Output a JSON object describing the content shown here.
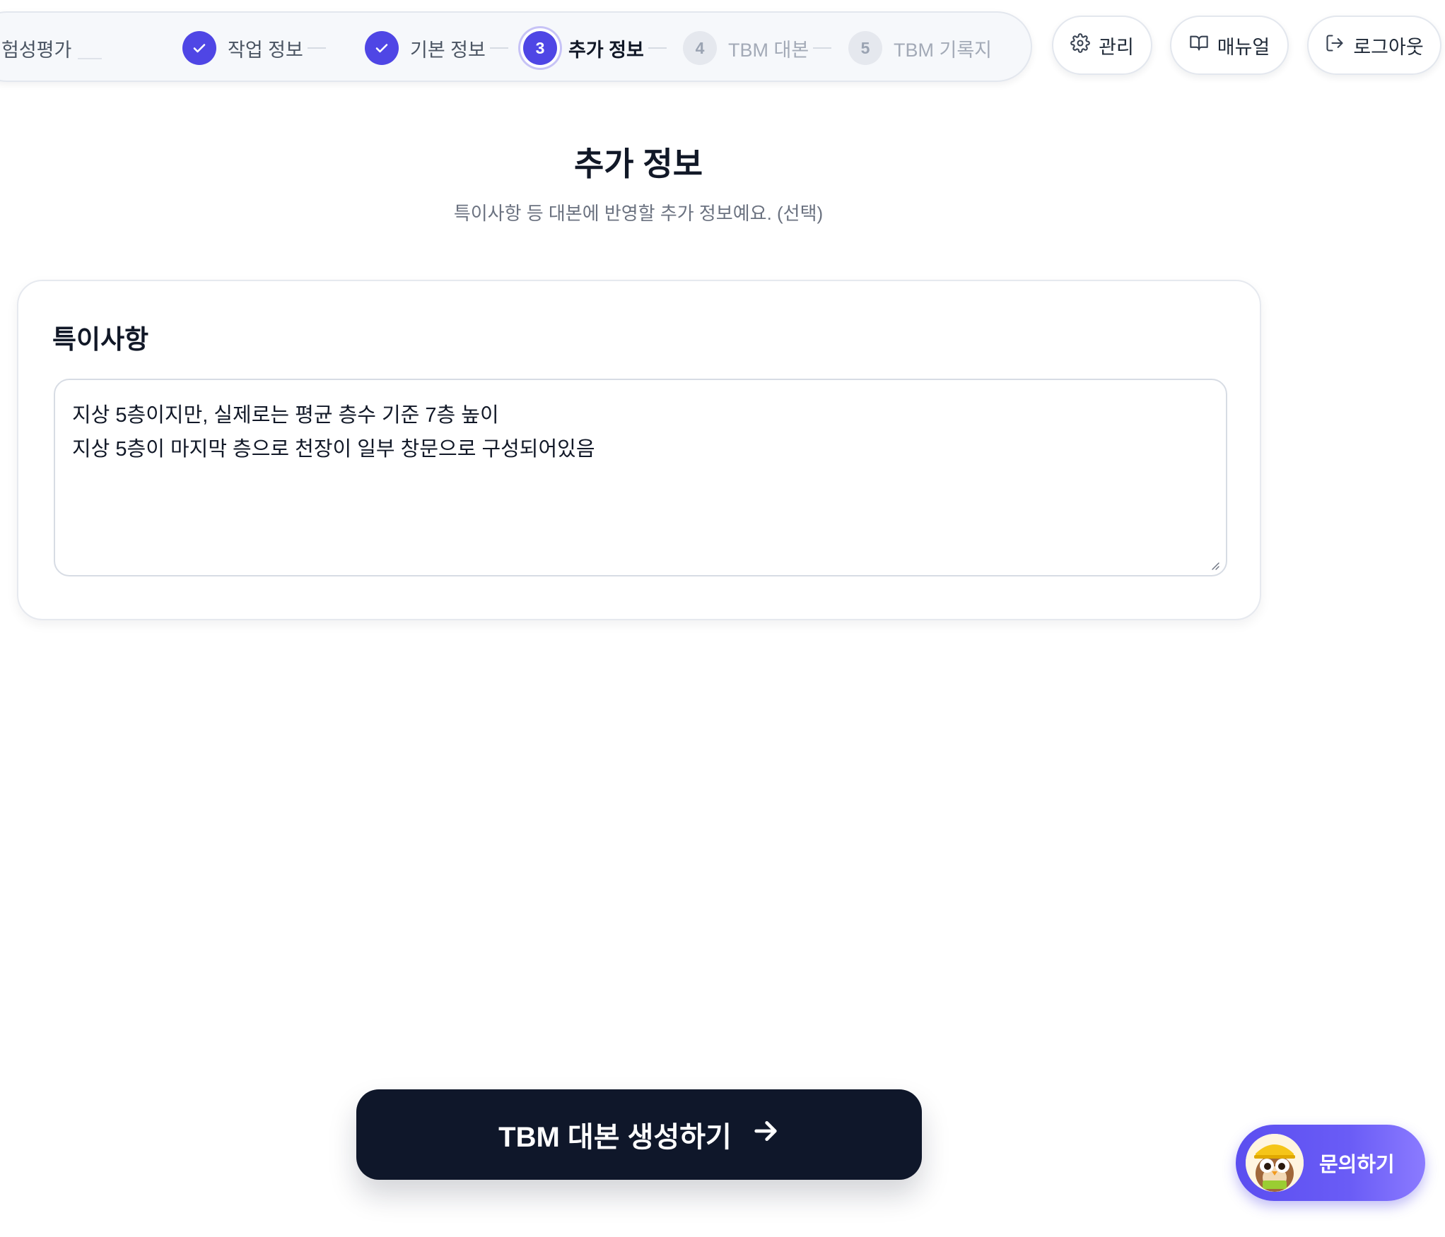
{
  "steps": [
    {
      "label": "험성평가",
      "state": "done"
    },
    {
      "label": "작업 정보",
      "state": "done"
    },
    {
      "label": "기본 정보",
      "state": "done"
    },
    {
      "number": "3",
      "label": "추가 정보",
      "state": "current"
    },
    {
      "number": "4",
      "label": "TBM 대본",
      "state": "future"
    },
    {
      "number": "5",
      "label": "TBM 기록지",
      "state": "future"
    }
  ],
  "header": {
    "admin_label": "관리",
    "manual_label": "매뉴얼",
    "logout_label": "로그아웃"
  },
  "main": {
    "title": "추가 정보",
    "subtitle": "특이사항 등 대본에 반영할 추가 정보예요. (선택)"
  },
  "notes": {
    "title": "특이사항",
    "lines": [
      "지상 5층이지만, 실제로는 평균 층수 기준 7층 높이",
      "지상 5층이 마지막 층으로 천장이 일부 창문으로 구성되어있음"
    ]
  },
  "actions": {
    "generate_label": "TBM 대본 생성하기"
  },
  "help": {
    "label": "문의하기"
  },
  "colors": {
    "accent": "#4f46e5",
    "primary_dark": "#0f172a",
    "muted_text": "#6b7280"
  }
}
